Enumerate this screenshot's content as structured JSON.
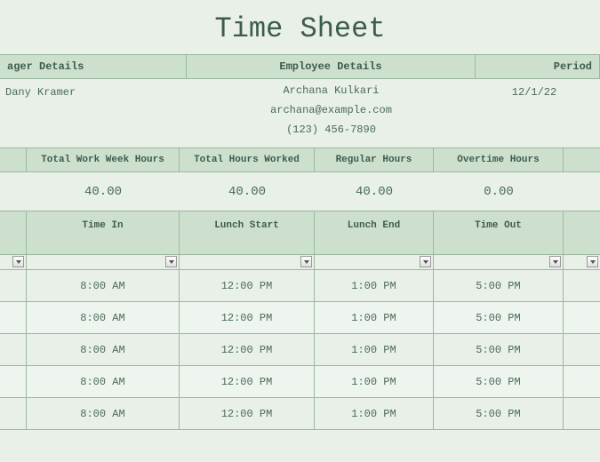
{
  "title": "Time Sheet",
  "details_header": {
    "manager": "ager Details",
    "employee": "Employee Details",
    "period": "Period"
  },
  "details": {
    "manager_name": "Dany Kramer",
    "employee_name": "Archana Kulkari",
    "employee_email": "archana@example.com",
    "employee_phone": "(123) 456-7890",
    "period_start": "12/1/22"
  },
  "summary_header": {
    "total_week": "Total Work Week Hours",
    "total_worked": "Total Hours Worked",
    "regular": "Regular Hours",
    "overtime": "Overtime Hours"
  },
  "summary_values": {
    "total_week": "40.00",
    "total_worked": "40.00",
    "regular": "40.00",
    "overtime": "0.00"
  },
  "times_header": {
    "time_in": "Time In",
    "lunch_start": "Lunch Start",
    "lunch_end": "Lunch End",
    "time_out": "Time Out"
  },
  "rows": [
    {
      "time_in": "8:00 AM",
      "lunch_start": "12:00 PM",
      "lunch_end": "1:00 PM",
      "time_out": "5:00 PM"
    },
    {
      "time_in": "8:00 AM",
      "lunch_start": "12:00 PM",
      "lunch_end": "1:00 PM",
      "time_out": "5:00 PM"
    },
    {
      "time_in": "8:00 AM",
      "lunch_start": "12:00 PM",
      "lunch_end": "1:00 PM",
      "time_out": "5:00 PM"
    },
    {
      "time_in": "8:00 AM",
      "lunch_start": "12:00 PM",
      "lunch_end": "1:00 PM",
      "time_out": "5:00 PM"
    },
    {
      "time_in": "8:00 AM",
      "lunch_start": "12:00 PM",
      "lunch_end": "1:00 PM",
      "time_out": "5:00 PM"
    }
  ]
}
